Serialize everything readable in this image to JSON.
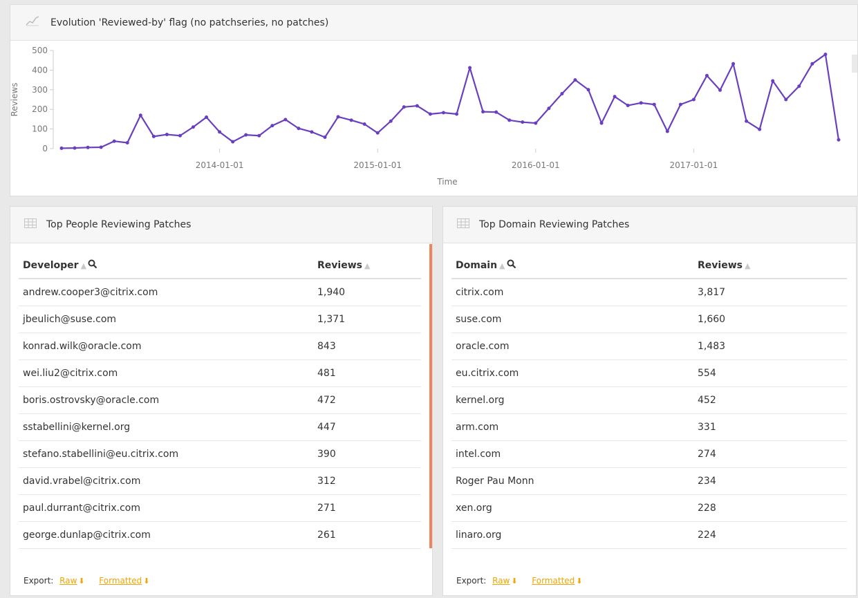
{
  "chart_panel": {
    "title": "Evolution 'Reviewed-by' flag (no patchseries, no patches)",
    "icon": "line-chart-icon"
  },
  "chart_data": {
    "type": "line",
    "xlabel": "Time",
    "ylabel": "Reviews",
    "ylim": [
      0,
      500
    ],
    "yticks": [
      0,
      100,
      200,
      300,
      400,
      500
    ],
    "xticks": [
      "2014-01-01",
      "2015-01-01",
      "2016-01-01",
      "2017-01-01"
    ],
    "grid": false,
    "color": "#6a3fbf",
    "x_start_month": "2013-01",
    "x_month_step": 1,
    "values": [
      2,
      3,
      6,
      7,
      38,
      30,
      170,
      62,
      72,
      66,
      110,
      160,
      85,
      35,
      70,
      66,
      117,
      148,
      103,
      85,
      58,
      162,
      145,
      125,
      80,
      140,
      212,
      218,
      176,
      183,
      176,
      412,
      188,
      186,
      145,
      135,
      130,
      205,
      280,
      350,
      300,
      130,
      265,
      220,
      233,
      225,
      88,
      225,
      250,
      372,
      298,
      432,
      140,
      98,
      345,
      250,
      318,
      432,
      480,
      45
    ]
  },
  "people_panel": {
    "title": "Top People Reviewing Patches",
    "icon": "table-icon",
    "col1": "Developer",
    "col2": "Reviews",
    "rows": [
      {
        "name": "andrew.cooper3@citrix.com",
        "value": "1,940"
      },
      {
        "name": "jbeulich@suse.com",
        "value": "1,371"
      },
      {
        "name": "konrad.wilk@oracle.com",
        "value": "843"
      },
      {
        "name": "wei.liu2@citrix.com",
        "value": "481"
      },
      {
        "name": "boris.ostrovsky@oracle.com",
        "value": "472"
      },
      {
        "name": "sstabellini@kernel.org",
        "value": "447"
      },
      {
        "name": "stefano.stabellini@eu.citrix.com",
        "value": "390"
      },
      {
        "name": "david.vrabel@citrix.com",
        "value": "312"
      },
      {
        "name": "paul.durrant@citrix.com",
        "value": "271"
      },
      {
        "name": "george.dunlap@citrix.com",
        "value": "261"
      }
    ]
  },
  "domain_panel": {
    "title": "Top Domain Reviewing Patches",
    "icon": "table-icon",
    "col1": "Domain",
    "col2": "Reviews",
    "rows": [
      {
        "name": "citrix.com",
        "value": "3,817"
      },
      {
        "name": "suse.com",
        "value": "1,660"
      },
      {
        "name": "oracle.com",
        "value": "1,483"
      },
      {
        "name": "eu.citrix.com",
        "value": "554"
      },
      {
        "name": "kernel.org",
        "value": "452"
      },
      {
        "name": "arm.com",
        "value": "331"
      },
      {
        "name": "intel.com",
        "value": "274"
      },
      {
        "name": "Roger Pau Monn",
        "value": "234"
      },
      {
        "name": "xen.org",
        "value": "228"
      },
      {
        "name": "linaro.org",
        "value": "224"
      }
    ]
  },
  "export": {
    "label": "Export:",
    "raw": "Raw",
    "formatted": "Formatted"
  },
  "colors": {
    "accent": "#f0a500",
    "line": "#6a3fbf",
    "scroll_accent": "#f0845c"
  }
}
